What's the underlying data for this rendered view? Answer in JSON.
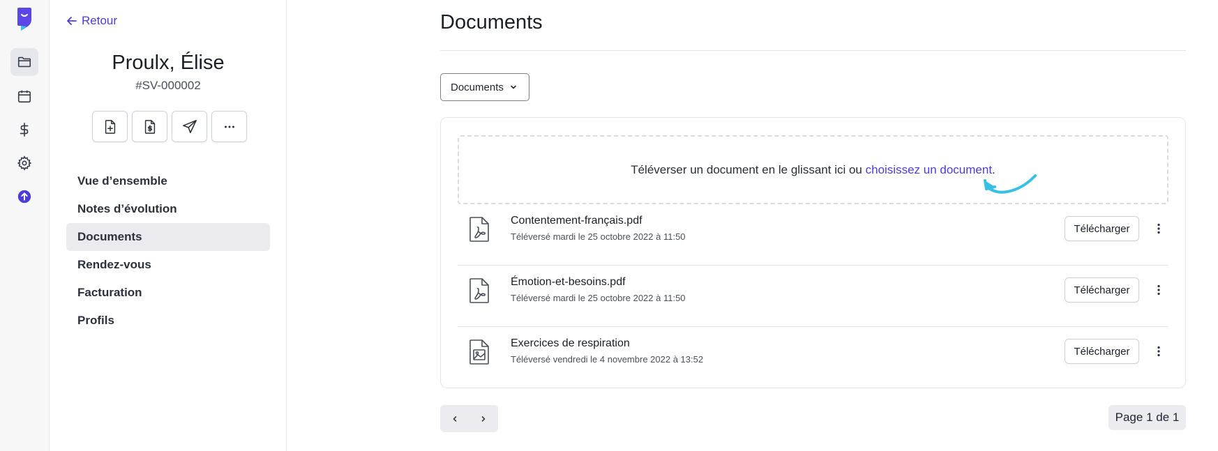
{
  "rail": {
    "items": [
      {
        "icon": "folder-icon"
      },
      {
        "icon": "calendar-icon"
      },
      {
        "icon": "dollar-icon"
      },
      {
        "icon": "gear-icon"
      },
      {
        "icon": "upgrade-arrow-icon"
      }
    ],
    "accent": "#4c3dd6",
    "logo_color": "#5b46e6"
  },
  "panel": {
    "back_label": "Retour",
    "client_name": "Proulx, Élise",
    "client_id": "#SV-000002",
    "actions": [
      "new-document-icon",
      "invoice-icon",
      "send-icon",
      "more-icon"
    ],
    "nav": [
      {
        "label": "Vue d’ensemble"
      },
      {
        "label": "Notes d’évolution"
      },
      {
        "label": "Documents",
        "active": true
      },
      {
        "label": "Rendez-vous"
      },
      {
        "label": "Facturation"
      },
      {
        "label": "Profils"
      }
    ]
  },
  "main": {
    "title": "Documents",
    "filter_label": "Documents",
    "dropzone": {
      "text": "Téléverser un document en le glissant ici ou ",
      "link": "choisissez un document",
      "suffix": "."
    },
    "files": [
      {
        "name": "Contentement-français.pdf",
        "meta": "Téléversé mardi le 25 octobre 2022 à 11:50",
        "icon": "pdf-file-icon",
        "action": "Télécharger"
      },
      {
        "name": "Émotion-et-besoins.pdf",
        "meta": "Téléversé mardi le 25 octobre 2022 à 11:50",
        "icon": "pdf-file-icon",
        "action": "Télécharger"
      },
      {
        "name": "Exercices de respiration",
        "meta": "Téléversé vendredi le 4 novembre 2022 à 13:52",
        "icon": "image-file-icon",
        "action": "Télécharger"
      }
    ],
    "page_info": "Page 1 de 1"
  }
}
